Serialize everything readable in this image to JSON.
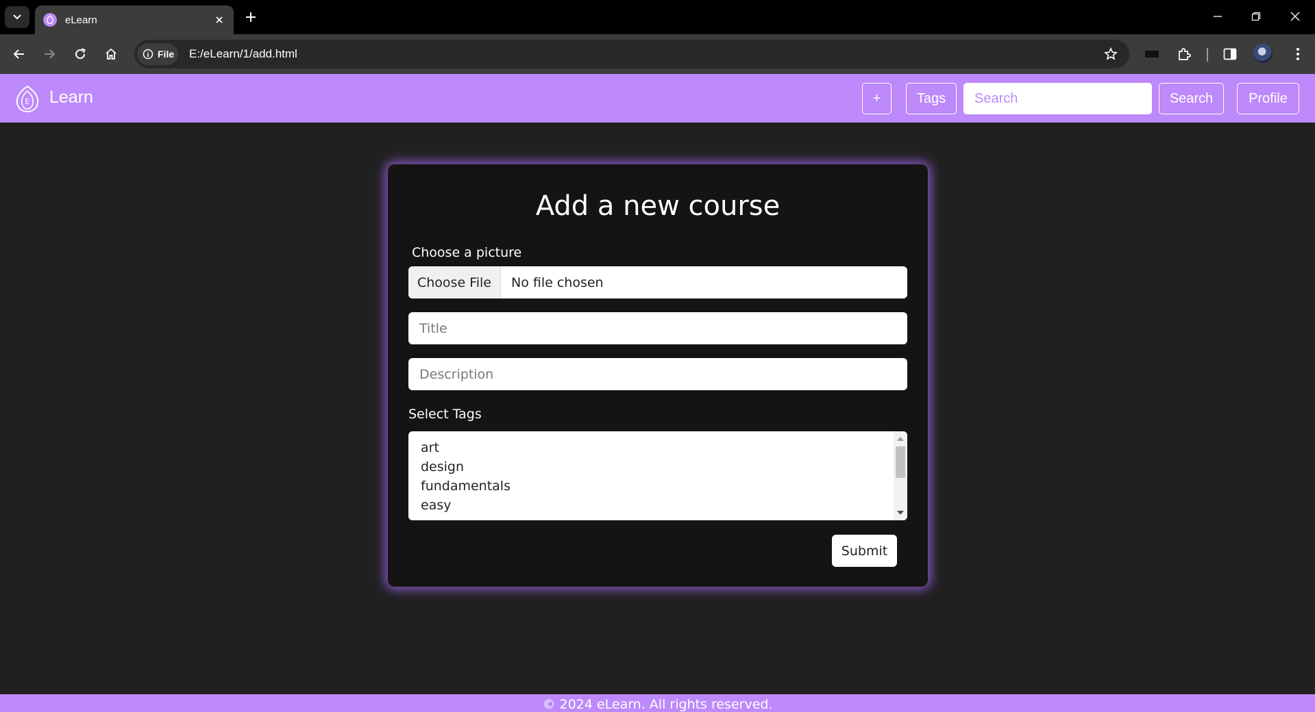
{
  "browser": {
    "tab_title": "eLearn",
    "site_chip_label": "File",
    "url": "E:/eLearn/1/add.html"
  },
  "navbar": {
    "brand": "Learn",
    "add_label": "+",
    "tags_label": "Tags",
    "search_placeholder": "Search",
    "search_button": "Search",
    "profile_label": "Profile"
  },
  "form": {
    "title": "Add a new course",
    "picture_label": "Choose a picture",
    "choose_file_label": "Choose File",
    "file_status": "No file chosen",
    "title_placeholder": "Title",
    "description_placeholder": "Description",
    "tags_label": "Select Tags",
    "tag_options": [
      "art",
      "design",
      "fundamentals",
      "easy"
    ],
    "submit_label": "Submit"
  },
  "footer": {
    "text": "© 2024 eLearn. All rights reserved."
  },
  "colors": {
    "brand": "#bd89fb",
    "page_background": "#202020",
    "card_background": "#141414"
  }
}
